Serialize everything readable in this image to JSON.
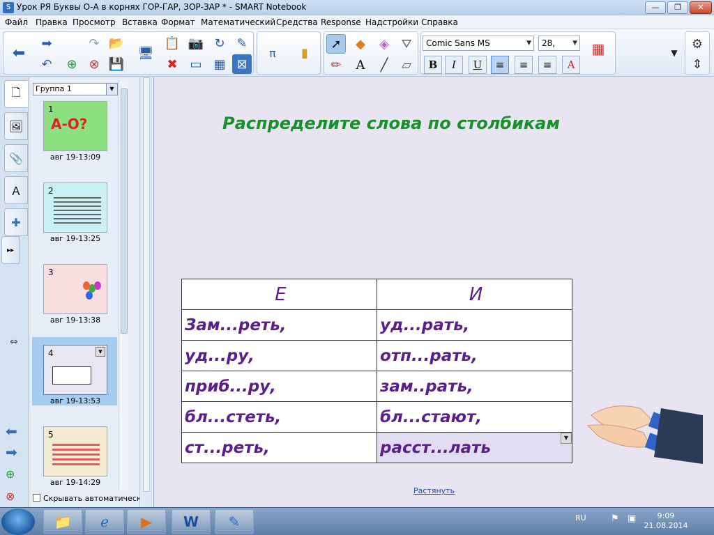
{
  "window": {
    "title": "Урок РЯ Буквы О-А в корнях ГОР-ГАР, ЗОР-ЗАР * - SMART Notebook",
    "buttons": {
      "minimize": "—",
      "maximize": "❐",
      "close": "✕"
    }
  },
  "menu": [
    "Файл",
    "Правка",
    "Просмотр",
    "Вставка",
    "Формат",
    "Математический",
    "Средства",
    "Response",
    "Надстройки",
    "Справка"
  ],
  "toolbar": {
    "font_name": "Comic Sans MS",
    "font_size": "28,",
    "format": {
      "bold": "B",
      "italic": "I",
      "underline": "U"
    }
  },
  "sorter": {
    "group": "Группа 1",
    "pages": [
      {
        "num": "1",
        "time": "авг 19-13:09",
        "thumb_text": "А-О?"
      },
      {
        "num": "2",
        "time": "авг 19-13:25"
      },
      {
        "num": "3",
        "time": "авг 19-13:38"
      },
      {
        "num": "4",
        "time": "авг 19-13:53"
      },
      {
        "num": "5",
        "time": "авг 19-14:29"
      }
    ],
    "autohide": "Скрывать автоматическ"
  },
  "page": {
    "heading": "Распределите слова по столбикам",
    "table": {
      "headers": [
        "Е",
        "И"
      ],
      "rows": [
        [
          "Зам...реть,",
          "уд...рать,"
        ],
        [
          "уд...ру,",
          "отп...рать,"
        ],
        [
          "приб...ру,",
          "зам..рать,"
        ],
        [
          "бл...стеть,",
          "бл...стают,"
        ],
        [
          "ст...реть,",
          "расст...лать"
        ]
      ]
    },
    "stretch_link": "Растянуть"
  },
  "taskbar": {
    "lang": "RU",
    "time": "9:09",
    "date": "21.08.2014"
  },
  "colors": {
    "heading": "#1a8f2c",
    "table_text": "#5b1f8c",
    "canvas_bg": "#e8e4f1"
  }
}
